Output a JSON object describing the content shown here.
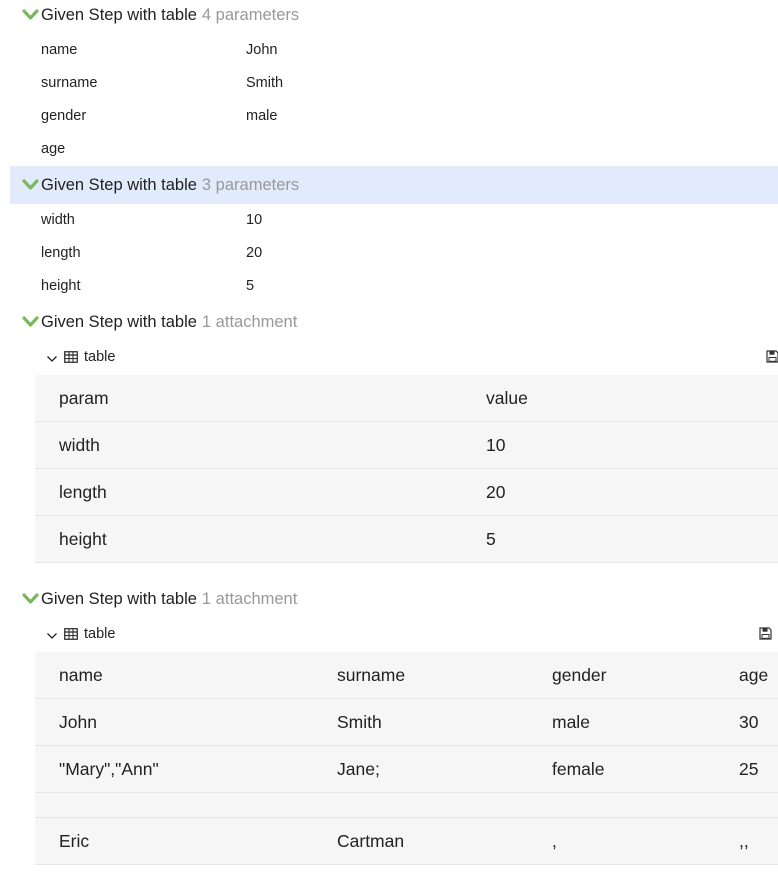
{
  "steps": [
    {
      "title": "Given Step with table",
      "meta": "4 parameters",
      "params": [
        {
          "name": "name",
          "value": "John"
        },
        {
          "name": "surname",
          "value": "Smith"
        },
        {
          "name": "gender",
          "value": "male"
        },
        {
          "name": "age",
          "value": ""
        }
      ]
    },
    {
      "title": "Given Step with table",
      "meta": "3 parameters",
      "params": [
        {
          "name": "width",
          "value": "10"
        },
        {
          "name": "length",
          "value": "20"
        },
        {
          "name": "height",
          "value": "5"
        }
      ]
    },
    {
      "title": "Given Step with table",
      "meta": "1 attachment",
      "attachment": {
        "label": "table",
        "rows": [
          [
            "param",
            "value"
          ],
          [
            "width",
            "10"
          ],
          [
            "length",
            "20"
          ],
          [
            "height",
            "5"
          ]
        ]
      }
    },
    {
      "title": "Given Step with table",
      "meta": "1 attachment",
      "attachment": {
        "label": "table",
        "rows": [
          [
            "name",
            "surname",
            "gender",
            "age"
          ],
          [
            "John",
            "Smith",
            "male",
            "30"
          ],
          [
            "\"Mary\",\"Ann\"",
            "Jane;",
            "female",
            "25"
          ],
          [
            "",
            "",
            "",
            ""
          ],
          [
            "Eric",
            "Cartman",
            ",",
            ",,"
          ]
        ]
      }
    }
  ],
  "colors": {
    "accent_green": "#7ab85c",
    "highlight": "#e1ebfb",
    "meta_gray": "#999999"
  },
  "icons": {
    "expand": "chevron-down-icon",
    "table": "table-icon",
    "save": "save-icon",
    "toggle": "caret-down-icon"
  }
}
